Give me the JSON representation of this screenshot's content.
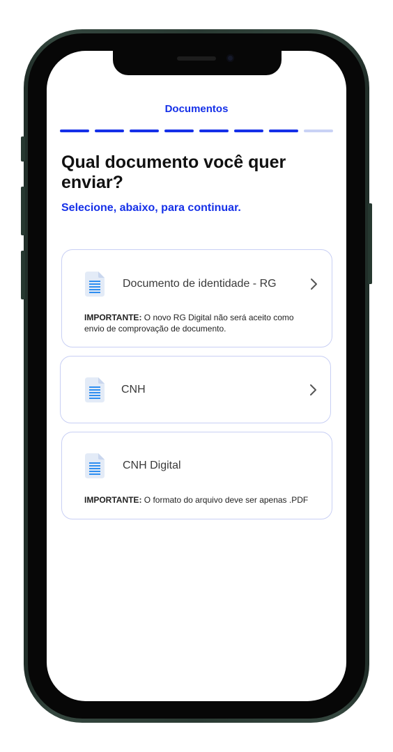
{
  "header": {
    "step_title": "Documentos",
    "progress_total": 8,
    "progress_completed": 7
  },
  "main": {
    "headline": "Qual documento você quer enviar?",
    "subtitle": "Selecione, abaixo, para continuar."
  },
  "documents": [
    {
      "label": "Documento de identidade - RG",
      "icon": "document-icon",
      "note_prefix": "IMPORTANTE:",
      "note_text": " O novo RG Digital não será aceito como envio de comprovação de documento.",
      "has_chevron": true
    },
    {
      "label": "CNH",
      "icon": "document-icon",
      "has_chevron": true
    },
    {
      "label": "CNH Digital",
      "icon": "document-icon",
      "note_prefix": "IMPORTANTE:",
      "note_text": " O formato do arquivo deve ser apenas .PDF",
      "has_chevron": false
    }
  ],
  "colors": {
    "accent": "#1530e8",
    "progress_pending": "#c9d2f5",
    "card_border": "#c8cff4",
    "icon_fill": "#e3ebf7",
    "icon_lines": "#2e8ef0"
  }
}
